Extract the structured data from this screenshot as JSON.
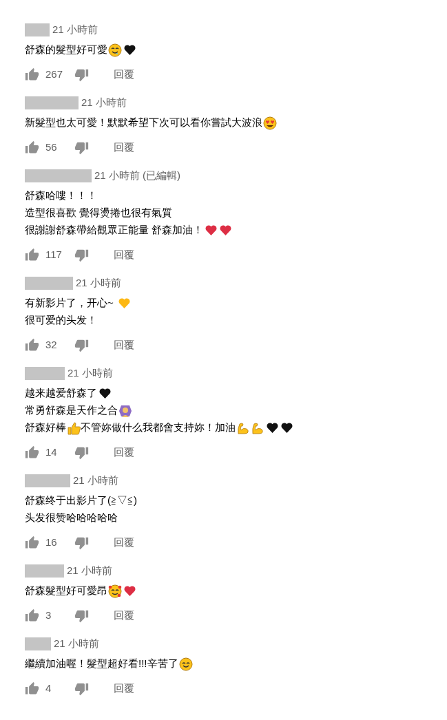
{
  "comments": [
    {
      "time": "21 小時前",
      "lines": [
        [
          {
            "kind": "text",
            "text": "舒森的髮型好可愛"
          },
          {
            "kind": "drool"
          },
          {
            "kind": "heart",
            "color": "#111111"
          }
        ]
      ],
      "likes": "267",
      "reply": "回覆"
    },
    {
      "time": "21 小時前",
      "lines": [
        [
          {
            "kind": "text",
            "text": "新髮型也太可愛！默默希望下次可以看你嘗試大波浪"
          },
          {
            "kind": "hearteyes"
          }
        ]
      ],
      "likes": "56",
      "reply": "回覆"
    },
    {
      "time": "21 小時前 (已編輯)",
      "lines": [
        [
          {
            "kind": "text",
            "text": "舒森哈嘍！！！"
          }
        ],
        [
          {
            "kind": "text",
            "text": "造型很喜歡 覺得燙捲也很有氣質"
          }
        ],
        [
          {
            "kind": "text",
            "text": "很謝謝舒森帶給觀眾正能量 舒森加油！"
          },
          {
            "kind": "heart",
            "color": "#dd2e44"
          },
          {
            "kind": "heart",
            "color": "#dd2e44"
          }
        ]
      ],
      "likes": "117",
      "reply": "回覆"
    },
    {
      "time": "21 小時前",
      "lines": [
        [
          {
            "kind": "text",
            "text": "有新影片了，开心~ "
          },
          {
            "kind": "heart",
            "color": "#fdb813"
          }
        ],
        [
          {
            "kind": "text",
            "text": "很可爱的头发！"
          }
        ]
      ],
      "likes": "32",
      "reply": "回覆"
    },
    {
      "time": "21 小時前",
      "lines": [
        [
          {
            "kind": "text",
            "text": "越来越爱舒森了"
          },
          {
            "kind": "heart",
            "color": "#111111"
          }
        ],
        [
          {
            "kind": "text",
            "text": "常勇舒森是天作之合"
          },
          {
            "kind": "gesture"
          }
        ],
        [
          {
            "kind": "text",
            "text": "舒森好棒"
          },
          {
            "kind": "thumb"
          },
          {
            "kind": "text",
            "text": "不管妳做什么我都會支持妳！加油"
          },
          {
            "kind": "flex"
          },
          {
            "kind": "flex"
          },
          {
            "kind": "heart",
            "color": "#111111"
          },
          {
            "kind": "heart",
            "color": "#111111"
          }
        ]
      ],
      "likes": "14",
      "reply": "回覆"
    },
    {
      "time": "21 小時前",
      "lines": [
        [
          {
            "kind": "text",
            "text": "舒森终于出影片了(≧▽≦)"
          }
        ],
        [
          {
            "kind": "text",
            "text": "头发很赞哈哈哈哈哈"
          }
        ]
      ],
      "likes": "16",
      "reply": "回覆"
    },
    {
      "time": "21 小時前",
      "lines": [
        [
          {
            "kind": "text",
            "text": "舒森髮型好可愛昂"
          },
          {
            "kind": "smilehearts"
          },
          {
            "kind": "heart",
            "color": "#dd2e44"
          }
        ]
      ],
      "likes": "3",
      "reply": "回覆"
    },
    {
      "time": "21 小時前",
      "lines": [
        [
          {
            "kind": "text",
            "text": "繼續加油喔！髮型超好看!!!辛苦了"
          },
          {
            "kind": "smile"
          }
        ]
      ],
      "likes": "4",
      "reply": "回覆"
    }
  ]
}
